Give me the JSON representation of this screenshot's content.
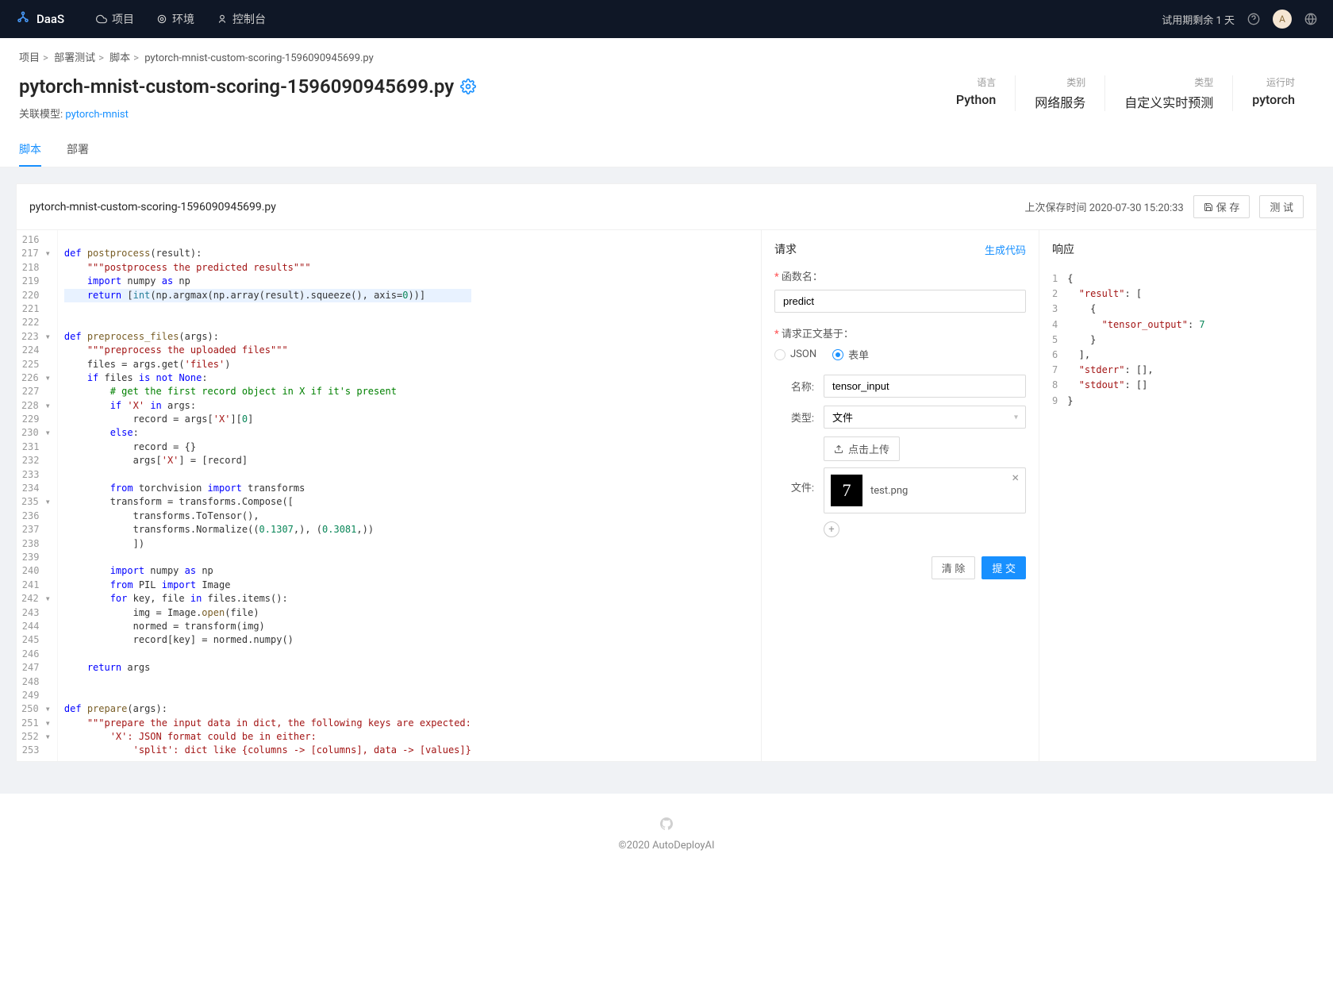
{
  "topbar": {
    "logo": "DaaS",
    "nav": [
      {
        "icon": "cloud",
        "label": "项目"
      },
      {
        "icon": "env",
        "label": "环境"
      },
      {
        "icon": "console",
        "label": "控制台"
      }
    ],
    "trial": "试用期剩余 1 天",
    "avatar": "A"
  },
  "breadcrumb": [
    "项目",
    "部署测试",
    "脚本",
    "pytorch-mnist-custom-scoring-1596090945699.py"
  ],
  "page": {
    "title": "pytorch-mnist-custom-scoring-1596090945699.py",
    "assoc_label": "关联模型:",
    "assoc_model": "pytorch-mnist"
  },
  "meta": [
    {
      "label": "语言",
      "value": "Python"
    },
    {
      "label": "类别",
      "value": "网络服务"
    },
    {
      "label": "类型",
      "value": "自定义实时预测"
    },
    {
      "label": "运行时",
      "value": "pytorch"
    }
  ],
  "tabs": [
    "脚本",
    "部署"
  ],
  "active_tab": 0,
  "card": {
    "filename": "pytorch-mnist-custom-scoring-1596090945699.py",
    "save_time_label": "上次保存时间",
    "save_time": "2020-07-30 15:20:33",
    "save_btn": "保 存",
    "test_btn": "测 试"
  },
  "request": {
    "title": "请求",
    "gen_code": "生成代码",
    "fn_label": "函数名：",
    "fn_value": "predict",
    "body_label": "请求正文基于：",
    "radio_json": "JSON",
    "radio_form": "表单",
    "name_label": "名称:",
    "name_value": "tensor_input",
    "type_label": "类型:",
    "type_value": "文件",
    "file_label": "文件:",
    "upload_btn": "点击上传",
    "uploaded_file": "test.png",
    "clear_btn": "清 除",
    "submit_btn": "提 交"
  },
  "response": {
    "title": "响应"
  },
  "footer": "©2020 AutoDeployAI"
}
